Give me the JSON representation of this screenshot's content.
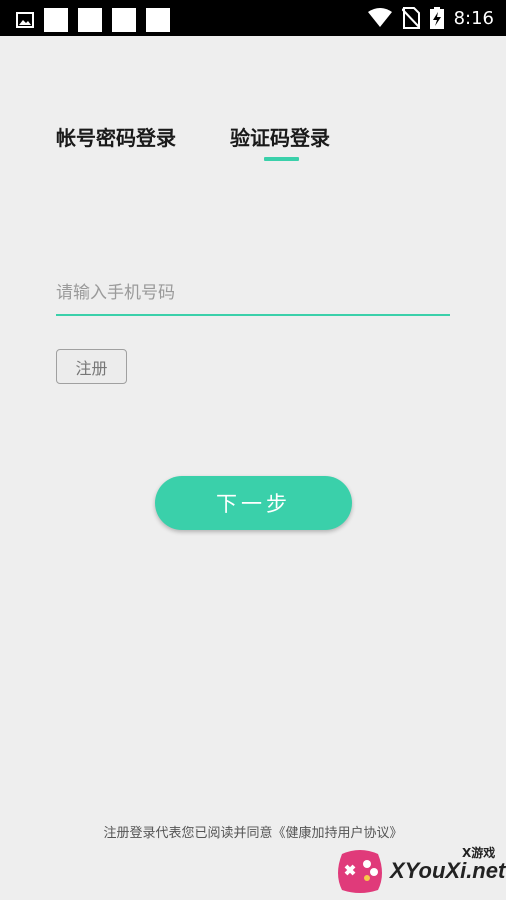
{
  "status_bar": {
    "time": "8:16",
    "icons": [
      "image-icon",
      "notification-square",
      "notification-square",
      "notification-square",
      "notification-square",
      "wifi-icon",
      "no-sim-icon",
      "battery-charging-icon"
    ]
  },
  "tabs": {
    "account_password": "帐号密码登录",
    "verification_code": "验证码登录",
    "active": "verification_code",
    "accent_color": "#3ad0aa"
  },
  "phone_input": {
    "value": "",
    "placeholder": "请输入手机号码"
  },
  "register_button": {
    "label": "注册"
  },
  "next_button": {
    "label": "下一步"
  },
  "agreement": {
    "text": "注册登录代表您已阅读并同意《健康加持用户协议》"
  },
  "watermark": {
    "text": "XYouXi.net",
    "small_text": "X游戏"
  }
}
